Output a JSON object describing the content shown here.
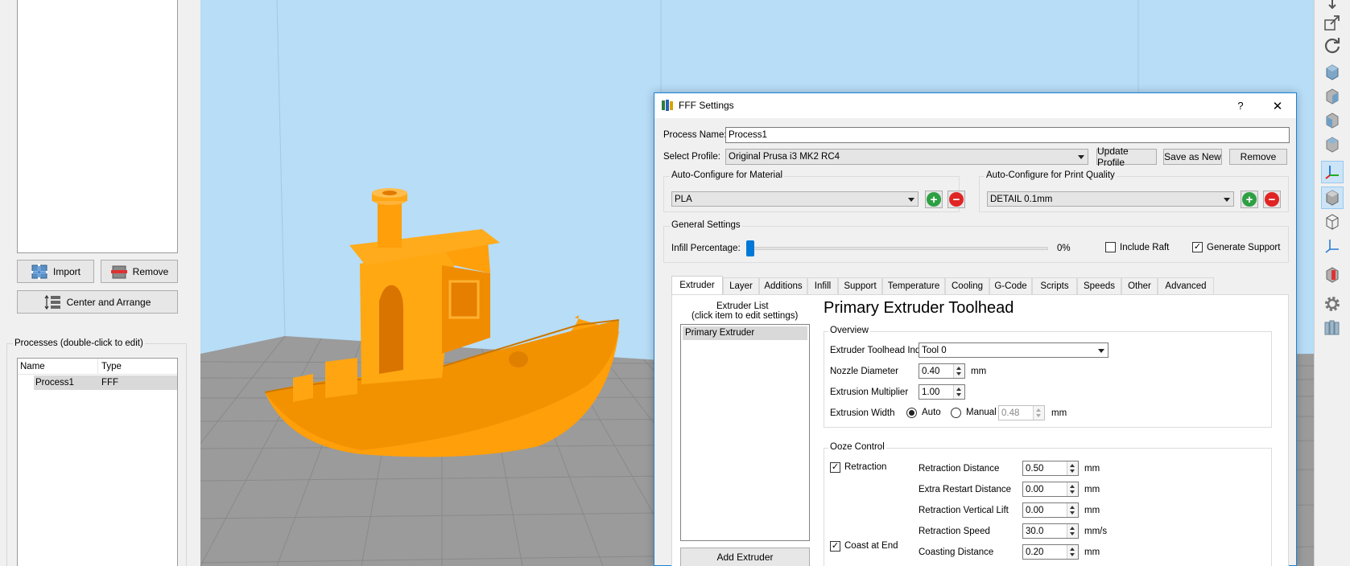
{
  "left_panel": {
    "import_label": "Import",
    "remove_label": "Remove",
    "center_arrange_label": "Center and Arrange",
    "processes_title": "Processes (double-click to edit)",
    "table_headers": [
      "Name",
      "Type"
    ],
    "rows": [
      {
        "name": "Process1",
        "type": "FFF"
      }
    ]
  },
  "dialog": {
    "title": "FFF Settings",
    "help_btn": "?",
    "close_btn": "✕",
    "process_name_label": "Process Name:",
    "process_name_value": "Process1",
    "select_profile_label": "Select Profile:",
    "profile_value": "Original Prusa i3 MK2 RC4",
    "update_profile_label": "Update Profile",
    "save_as_new_label": "Save as New",
    "remove_label": "Remove",
    "material_group_title": "Auto-Configure for Material",
    "material_value": "PLA",
    "quality_group_title": "Auto-Configure for Print Quality",
    "quality_value": "DETAIL 0.1mm",
    "general_group_title": "General Settings",
    "infill_label": "Infill Percentage:",
    "infill_value": "0%",
    "include_raft_label": "Include Raft",
    "generate_support_label": "Generate Support",
    "include_raft_checked": false,
    "generate_support_checked": true,
    "tabs": [
      "Extruder",
      "Layer",
      "Additions",
      "Infill",
      "Support",
      "Temperature",
      "Cooling",
      "G-Code",
      "Scripts",
      "Speeds",
      "Other",
      "Advanced"
    ],
    "active_tab": "Extruder",
    "extruder_list_title": "Extruder List",
    "extruder_list_hint": "(click item to edit settings)",
    "extruder_items": [
      "Primary Extruder"
    ],
    "add_extruder_label": "Add Extruder",
    "toolhead_heading": "Primary Extruder Toolhead",
    "overview_title": "Overview",
    "toolhead_index_label": "Extruder Toolhead Index",
    "toolhead_index_value": "Tool 0",
    "nozzle_label": "Nozzle Diameter",
    "nozzle_value": "0.40",
    "nozzle_unit": "mm",
    "extrusion_mult_label": "Extrusion Multiplier",
    "extrusion_mult_value": "1.00",
    "extrusion_width_label": "Extrusion Width",
    "auto_label": "Auto",
    "manual_label": "Manual",
    "manual_value": "0.48",
    "width_unit": "mm",
    "ooze_title": "Ooze Control",
    "retraction_label": "Retraction",
    "coast_label": "Coast at End",
    "retraction_dist_label": "Retraction Distance",
    "retraction_dist_value": "0.50",
    "extra_restart_label": "Extra Restart Distance",
    "extra_restart_value": "0.00",
    "vertical_lift_label": "Retraction Vertical Lift",
    "vertical_lift_value": "0.00",
    "retraction_speed_label": "Retraction Speed",
    "retraction_speed_value": "30.0",
    "coasting_dist_label": "Coasting Distance",
    "coasting_dist_value": "0.20",
    "unit_mm": "mm",
    "unit_mms": "mm/s"
  },
  "colors": {
    "viewport_bg": "#b7ddf7",
    "model": "#ff9f0a",
    "accent": "#1883d7"
  }
}
